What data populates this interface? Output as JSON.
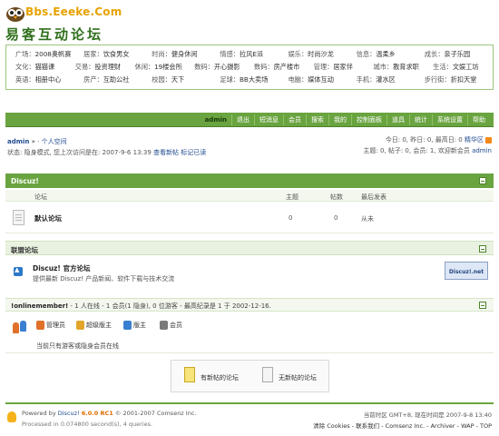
{
  "header": {
    "logo_text_en": "Bbs.Eeeke.Com",
    "logo_text_cn": "易客互动论坛"
  },
  "directory": {
    "rows": [
      [
        {
          "cat": "广场：",
          "val": "2008奥帆赛"
        },
        {
          "cat": "居家：",
          "val": "饮食男女"
        },
        {
          "cat": "时尚：",
          "val": "健身休闲"
        },
        {
          "cat": "情感：",
          "val": "拉风E派"
        },
        {
          "cat": "娱乐：",
          "val": "时尚沙龙"
        },
        {
          "cat": "信息：",
          "val": "温柔乡"
        },
        {
          "cat": "成长：",
          "val": "亲子乐园"
        }
      ],
      [
        {
          "cat": "文化：",
          "val": "猫猫课"
        },
        {
          "cat": "交易：",
          "val": "投资理财"
        },
        {
          "cat": "休闲：",
          "val": "19楼会所"
        },
        {
          "cat": "数码：",
          "val": "开心摄影"
        },
        {
          "cat": "数码：",
          "val": "房产楼市"
        },
        {
          "cat": "管理：",
          "val": "居家伴"
        },
        {
          "cat": "城市：",
          "val": "教育求职"
        },
        {
          "cat": "生活：",
          "val": "文娱工坊"
        }
      ],
      [
        {
          "cat": "英语：",
          "val": "相册中心"
        },
        {
          "cat": "房产：",
          "val": "互助公社"
        },
        {
          "cat": "校园：",
          "val": "天下"
        },
        {
          "cat": "足球：",
          "val": "BB大卖场"
        },
        {
          "cat": "电脑：",
          "val": "媒体互动"
        },
        {
          "cat": "手机：",
          "val": "灌水区"
        },
        {
          "cat": "步行街：",
          "val": "折扣天堂"
        }
      ]
    ]
  },
  "nav": {
    "items": [
      "admin",
      "退出",
      "短消息",
      "会员",
      "搜索",
      "我的",
      "控制面板",
      "道具",
      "统计",
      "系统设置",
      "帮助"
    ]
  },
  "info": {
    "user": "admin",
    "crumb_sep": " » · ",
    "crumb_page": "个人空间",
    "status_text": "状态: 隐身模式, 您上次访问是在: 2007-9-6 13:39",
    "link_new": "查看新帖",
    "link_mark": "标记已读",
    "stats_line1": "今日: 0, 昨日: 0, 最高日: 0",
    "stats_link": "精华区",
    "stats_line2": "主题: 0, 帖子: 0, 会员: 1, 欢迎新会员",
    "new_member": "admin"
  },
  "forum_section": {
    "title": "Discuz!",
    "col_forum": "论坛",
    "col_topics": "主题",
    "col_posts": "帖数",
    "col_last": "最后发表",
    "forums": [
      {
        "name": "默认论坛",
        "topics": "0",
        "posts": "0",
        "last": "从未"
      }
    ]
  },
  "league_section": {
    "title": "联盟论坛",
    "item_title": "Discuz! 官方论坛",
    "item_desc": "提供最新 Discuz! 产品新闻、软件下载与技术交流",
    "banner": "Discuz!.net"
  },
  "online": {
    "head_bold": "!onlinemember!",
    "head_text": " - 1 人在线 - 1 会员(1 隐身), 0 位游客 - 最高纪录是 1 于 2002-12-16.",
    "legend": [
      {
        "label": "管理员",
        "color": "#e0702a"
      },
      {
        "label": "超级版主",
        "color": "#e0a52a"
      },
      {
        "label": "版主",
        "color": "#3a7fcf"
      },
      {
        "label": "会员",
        "color": "#7a7a7a"
      }
    ],
    "note": "当前只有游客或隐身会员在线"
  },
  "newposts": {
    "with_new": "有新帖的论坛",
    "no_new": "无新帖的论坛"
  },
  "footer": {
    "powered_prefix": "Powered by ",
    "powered_name": "Discuz!",
    "version": "6.0.0 RC1",
    "copyright": " © 2001-2007 Comsenz Inc.",
    "processed": "Processed in 0.074800 second(s), 4 queries.",
    "time_text": "当前时区 GMT+8, 现在时间是 2007-9-8 13:40",
    "links": "清除 Cookies - 联系我们 - Comsenz Inc. - Archiver - WAP - TOP"
  },
  "colors": {
    "accent": "#6aa441",
    "link": "#1f4a8f"
  }
}
